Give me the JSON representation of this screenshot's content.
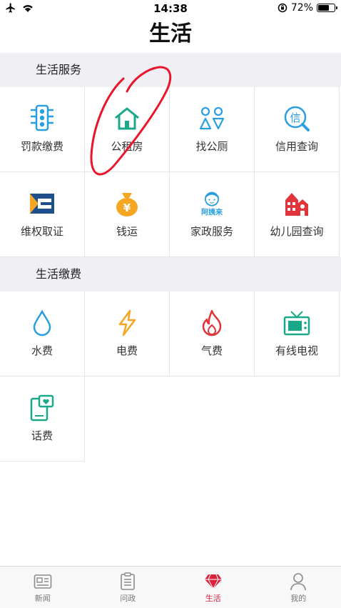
{
  "status_bar": {
    "time": "14:38",
    "battery": "72%",
    "battery_level": 0.72
  },
  "page": {
    "title": "生活"
  },
  "sections": [
    {
      "title": "生活服务",
      "items": [
        {
          "label": "罚款缴费",
          "icon": "traffic-light-icon"
        },
        {
          "label": "公租房",
          "icon": "house-icon"
        },
        {
          "label": "找公厕",
          "icon": "restroom-icon"
        },
        {
          "label": "信用查询",
          "icon": "credit-search-icon"
        },
        {
          "label": "维权取证",
          "icon": "evidence-icon"
        },
        {
          "label": "钱运",
          "icon": "money-bag-icon"
        },
        {
          "label": "家政服务",
          "icon": "housekeeping-icon"
        },
        {
          "label": "幼儿园查询",
          "icon": "kindergarten-icon"
        }
      ]
    },
    {
      "title": "生活缴费",
      "items": [
        {
          "label": "水费",
          "icon": "water-drop-icon"
        },
        {
          "label": "电费",
          "icon": "lightning-icon"
        },
        {
          "label": "气费",
          "icon": "flame-icon"
        },
        {
          "label": "有线电视",
          "icon": "tv-icon"
        },
        {
          "label": "话费",
          "icon": "phone-bill-icon"
        }
      ]
    }
  ],
  "icon_art_text": {
    "housekeeping": "阿姨来",
    "credit": "信",
    "money": "¥"
  },
  "tabs": [
    {
      "label": "新闻",
      "icon": "news-icon",
      "active": false
    },
    {
      "label": "问政",
      "icon": "clipboard-icon",
      "active": false
    },
    {
      "label": "生活",
      "icon": "diamond-icon",
      "active": true
    },
    {
      "label": "我的",
      "icon": "person-icon",
      "active": false
    }
  ],
  "colors": {
    "accent": "#d9233b",
    "annotation": "#e8152b",
    "blue": "#2a9fe0",
    "green": "#1aa88a",
    "orange": "#f5a623",
    "red": "#e0343b"
  }
}
